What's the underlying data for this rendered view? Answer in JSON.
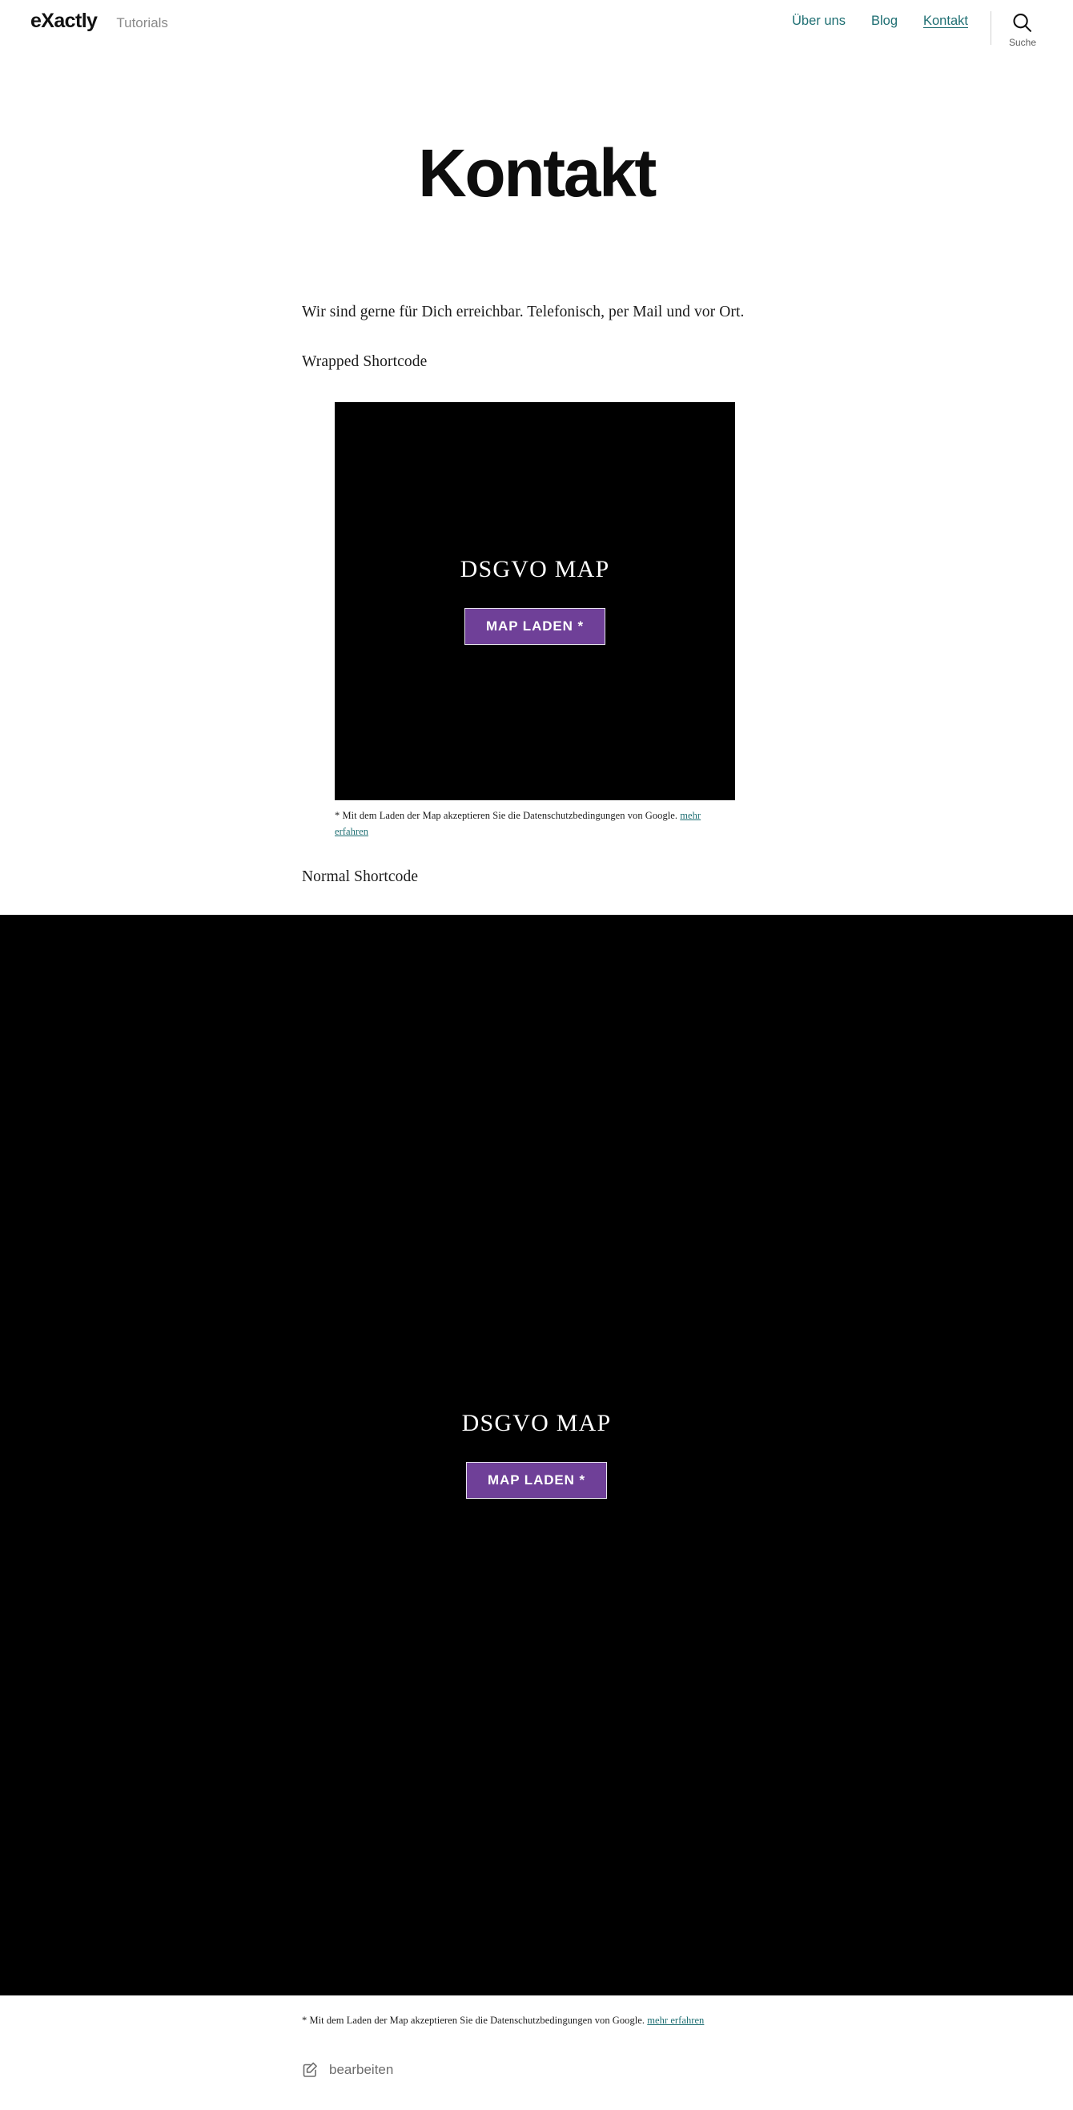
{
  "header": {
    "brand": "eXactly",
    "brand_sub": "Tutorials",
    "nav": [
      {
        "label": "Über uns",
        "active": false
      },
      {
        "label": "Blog",
        "active": false
      },
      {
        "label": "Kontakt",
        "active": true
      }
    ],
    "search_label": "Suche",
    "search_icon": "search-icon",
    "link_color": "#1f6f73"
  },
  "page": {
    "title": "Kontakt",
    "intro": "Wir sind gerne für Dich erreichbar. Telefonisch, per Mail und vor Ort.",
    "section_wrapped": "Wrapped Shortcode",
    "section_normal": "Normal Shortcode"
  },
  "map_wrapped": {
    "title": "DSGVO MAP",
    "button_label": "MAP LADEN *",
    "button_color": "#6f4098",
    "background": "#000000",
    "disclaimer_text": "* Mit dem Laden der Map akzeptieren Sie die Datenschutzbedingungen von Google.",
    "disclaimer_link": "mehr erfahren"
  },
  "map_full": {
    "title": "DSGVO MAP",
    "button_label": "MAP LADEN *",
    "button_color": "#6f4098",
    "background": "#000000",
    "disclaimer_text": "* Mit dem Laden der Map akzeptieren Sie die Datenschutzbedingungen von Google.",
    "disclaimer_link": "mehr erfahren"
  },
  "footer": {
    "edit_label": "bearbeiten",
    "edit_icon": "edit-pencil-square-icon"
  }
}
